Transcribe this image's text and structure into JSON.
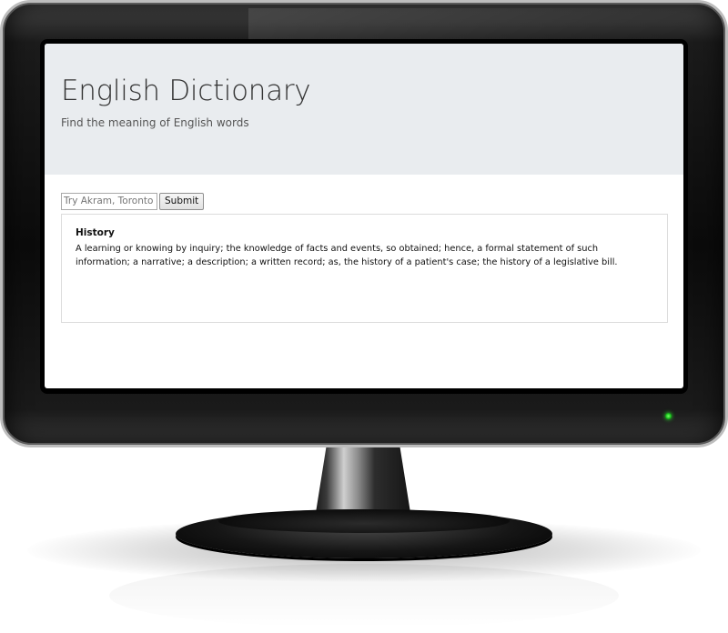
{
  "header": {
    "title": "English Dictionary",
    "subtitle": "Find the meaning of English words"
  },
  "search": {
    "placeholder": "Try Akram, Toronto",
    "value": "",
    "submit_label": "Submit"
  },
  "result": {
    "word": "History",
    "definition": "A learning or knowing by inquiry; the knowledge of facts and events, so obtained; hence, a formal statement of such information; a narrative; a description; a written record; as, the history of a patient's case; the history of a legislative bill."
  },
  "colors": {
    "jumbotron_bg": "#e9ecef",
    "power_led": "#17c21a"
  },
  "icons": [
    "power-led-icon"
  ]
}
